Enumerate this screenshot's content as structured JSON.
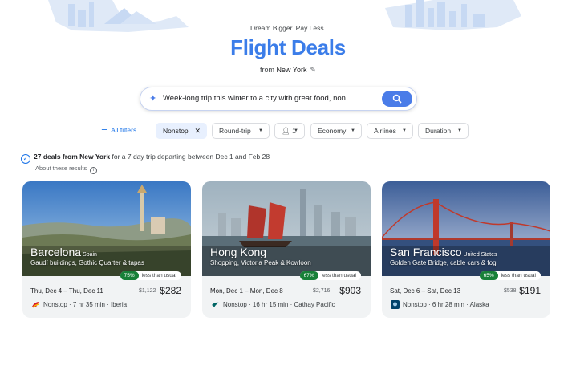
{
  "header": {
    "tagline": "Dream Bigger. Pay Less.",
    "title": "Flight Deals",
    "from_prefix": "from",
    "from_city": "New York"
  },
  "search": {
    "query": "Week-long trip this winter to a city with great food, non. ."
  },
  "filters": {
    "all_filters": "All filters",
    "nonstop": "Nonstop",
    "trip_type": "Round-trip",
    "passengers": "1",
    "cabin": "Economy",
    "airlines": "Airlines",
    "duration": "Duration"
  },
  "results": {
    "count_text": "27 deals from New York",
    "detail_text": " for a 7 day trip departing between Dec 1 and Feb 28",
    "about": "About these results"
  },
  "deals": [
    {
      "city": "Barcelona",
      "country": "Spain",
      "desc": "Gaudí buildings, Gothic Quarter & tapas",
      "pct": "75%",
      "badge_text": "less than usual",
      "dates": "Thu, Dec 4 – Thu, Dec 11",
      "old_price": "$1,122",
      "price": "$282",
      "flight": "Nonstop · 7 hr 35 min · Iberia",
      "colors": {
        "sky_top": "#3a78c4",
        "sky_bottom": "#a9cbe9",
        "ground": "#6d7a55"
      }
    },
    {
      "city": "Hong Kong",
      "country": "",
      "desc": "Shopping, Victoria Peak & Kowloon",
      "pct": "67%",
      "badge_text": "less than usual",
      "dates": "Mon, Dec 1 – Mon, Dec 8",
      "old_price": "$2,716",
      "price": "$903",
      "flight": "Nonstop · 16 hr 15 min · Cathay Pacific",
      "colors": {
        "sky_top": "#9fb2bf",
        "sky_bottom": "#c8d2d8",
        "ground": "#5b6e78"
      }
    },
    {
      "city": "San Francisco",
      "country": "United States",
      "desc": "Golden Gate Bridge, cable cars & fog",
      "pct": "65%",
      "badge_text": "less than usual",
      "dates": "Sat, Dec 6 – Sat, Dec 13",
      "old_price": "$538",
      "price": "$191",
      "flight": "Nonstop · 6 hr 28 min · Alaska",
      "colors": {
        "sky_top": "#3c5e98",
        "sky_bottom": "#c9d3e6",
        "ground": "#34507e"
      }
    }
  ],
  "colors": {
    "accent": "#3b7de9",
    "badge_green": "#188038"
  }
}
